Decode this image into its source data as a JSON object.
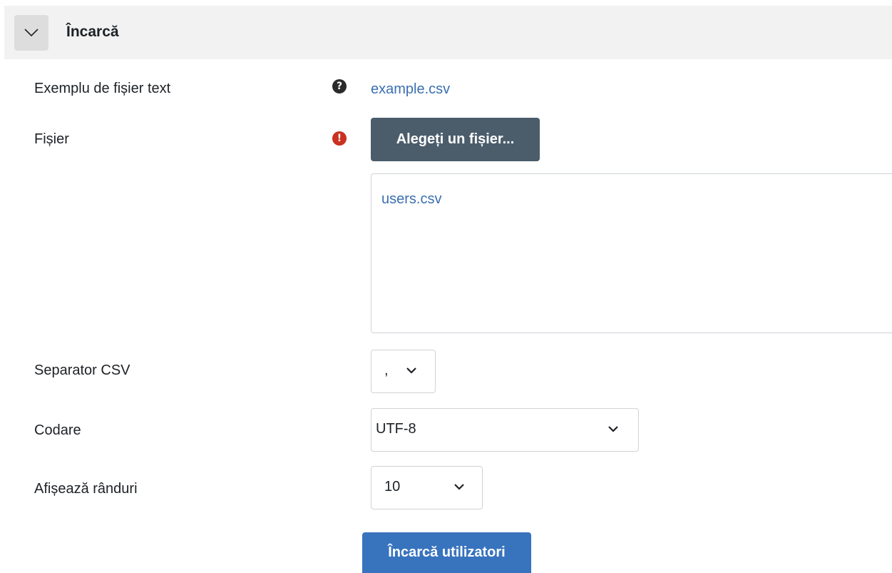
{
  "section": {
    "title": "Încarcă",
    "toggle_icon": "chevron-down-icon"
  },
  "rows": {
    "example": {
      "label": "Exemplu de fișier text",
      "icon": "help-icon",
      "icon_glyph": "?",
      "link": "example.csv"
    },
    "file": {
      "label": "Fișier",
      "icon": "required-icon",
      "icon_glyph": "!",
      "choose_button": "Alegeți un fișier...",
      "selected_file": "users.csv"
    },
    "separator": {
      "label": "Separator CSV",
      "value": ","
    },
    "encoding": {
      "label": "Codare",
      "value": "UTF-8"
    },
    "preview_rows": {
      "label": "Afișează rânduri",
      "value": "10"
    }
  },
  "submit_label": "Încarcă utilizatori",
  "colors": {
    "link": "#3a6fb0",
    "primary_button": "#3873be",
    "secondary_button": "#4b5d6b",
    "required": "#ca3120"
  }
}
